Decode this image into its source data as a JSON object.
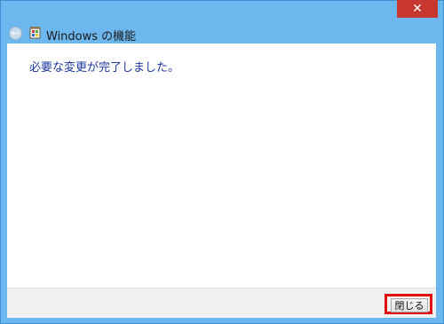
{
  "window": {
    "close_glyph": "✕"
  },
  "header": {
    "back_glyph": "←",
    "title": "Windows の機能"
  },
  "main": {
    "message": "必要な変更が完了しました。"
  },
  "footer": {
    "close_label": "閉じる"
  },
  "colors": {
    "chrome": "#6cb7ee",
    "close_button": "#c7372f",
    "message_text": "#1d3aa0",
    "highlight": "#e10f0f"
  },
  "icons": {
    "back": "back-arrow-icon",
    "app": "windows-features-icon",
    "close": "close-icon"
  }
}
